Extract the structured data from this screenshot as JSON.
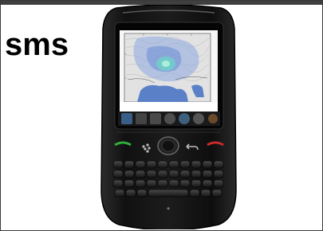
{
  "label": "sms",
  "phone_brand": "blackberry-logo-icon",
  "colors": {
    "phone_body": "#121212",
    "screen_sea": "#5a80c8",
    "map_land": "#dcdcdc",
    "quake_marker": "#6fd0c8"
  }
}
